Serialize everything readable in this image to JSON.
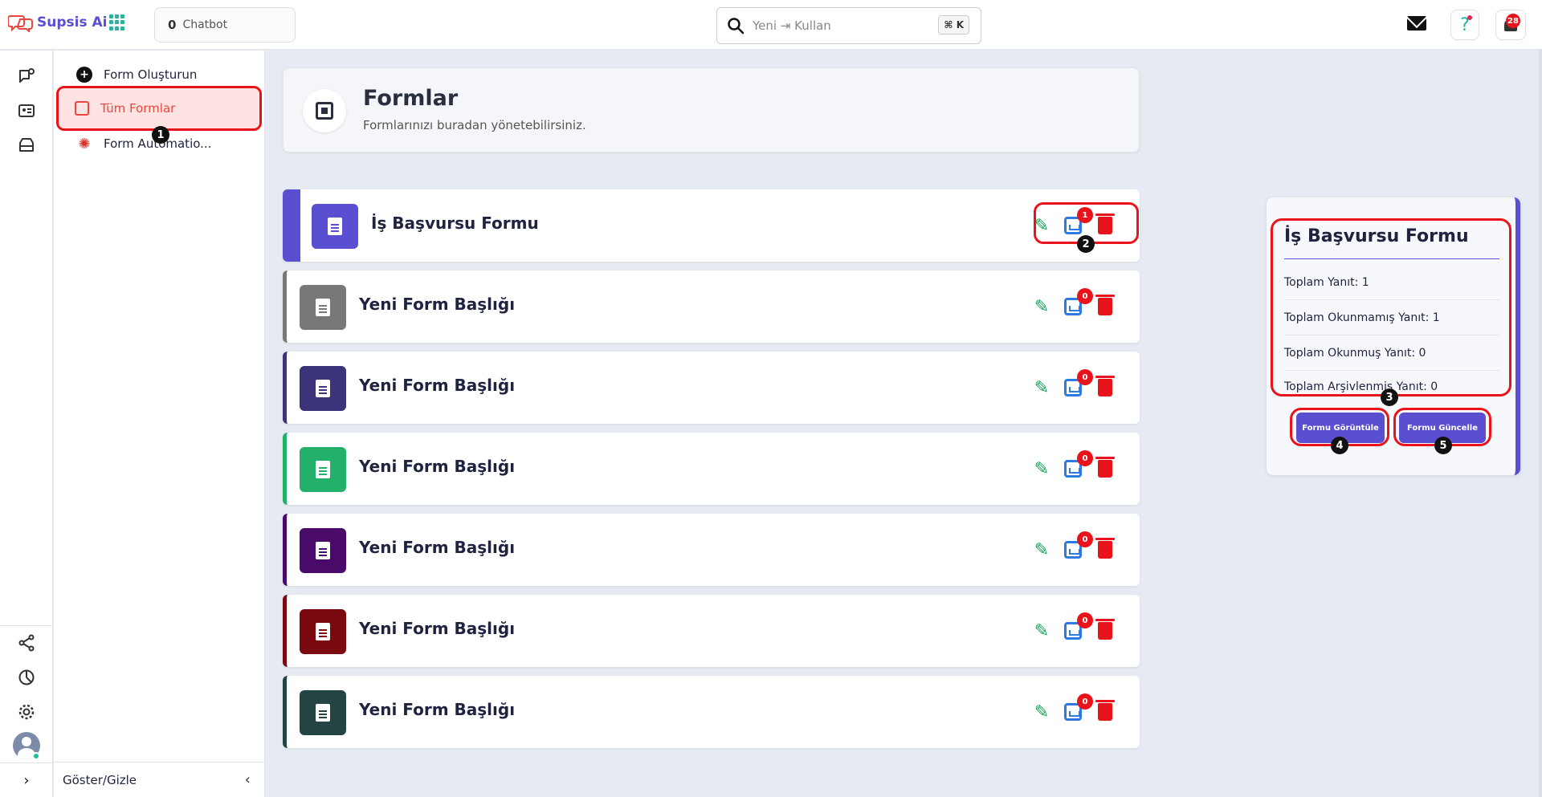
{
  "topbar": {
    "brand": "Supsis Ai",
    "chatbot_count": "0",
    "chatbot_label": "Chatbot",
    "search_value": "Yeni ⇥ Kullan",
    "shortcut": "⌘ K",
    "help_glyph": "?",
    "notifications": "28"
  },
  "sidebar": {
    "items": [
      {
        "label": "Form Oluşturun",
        "icon": "plus-circle-icon"
      },
      {
        "label": "Tüm Formlar",
        "icon": "frame-icon"
      },
      {
        "label": "Form Automatio..."
      }
    ],
    "footer_label": "Göster/Gizle"
  },
  "header": {
    "title": "Formlar",
    "subtitle": "Formlarınızı buradan yönetebilirsiniz."
  },
  "forms": [
    {
      "title": "İş Başvursu Formu",
      "color": "#5b4fd1",
      "count": "1"
    },
    {
      "title": "Yeni Form Başlığı",
      "color": "#787878",
      "count": "0"
    },
    {
      "title": "Yeni Form Başlığı",
      "color": "#3b3479",
      "count": "0"
    },
    {
      "title": "Yeni Form Başlığı",
      "color": "#22b06a",
      "count": "0"
    },
    {
      "title": "Yeni Form Başlığı",
      "color": "#4a0a6a",
      "count": "0"
    },
    {
      "title": "Yeni Form Başlığı",
      "color": "#7a0a10",
      "count": "0"
    },
    {
      "title": "Yeni Form Başlığı",
      "color": "#234443",
      "count": "0"
    }
  ],
  "details": {
    "title": "İş Başvursu Formu",
    "stats": [
      "Toplam Yanıt: 1",
      "Toplam Okunmamış Yanıt: 1",
      "Toplam Okunmuş Yanıt: 0",
      "Toplam Arşivlenmiş Yanıt: 0"
    ],
    "view_button": "Formu Görüntüle",
    "update_button": "Formu Güncelle"
  },
  "markers": [
    "1",
    "2",
    "3",
    "4",
    "5"
  ]
}
